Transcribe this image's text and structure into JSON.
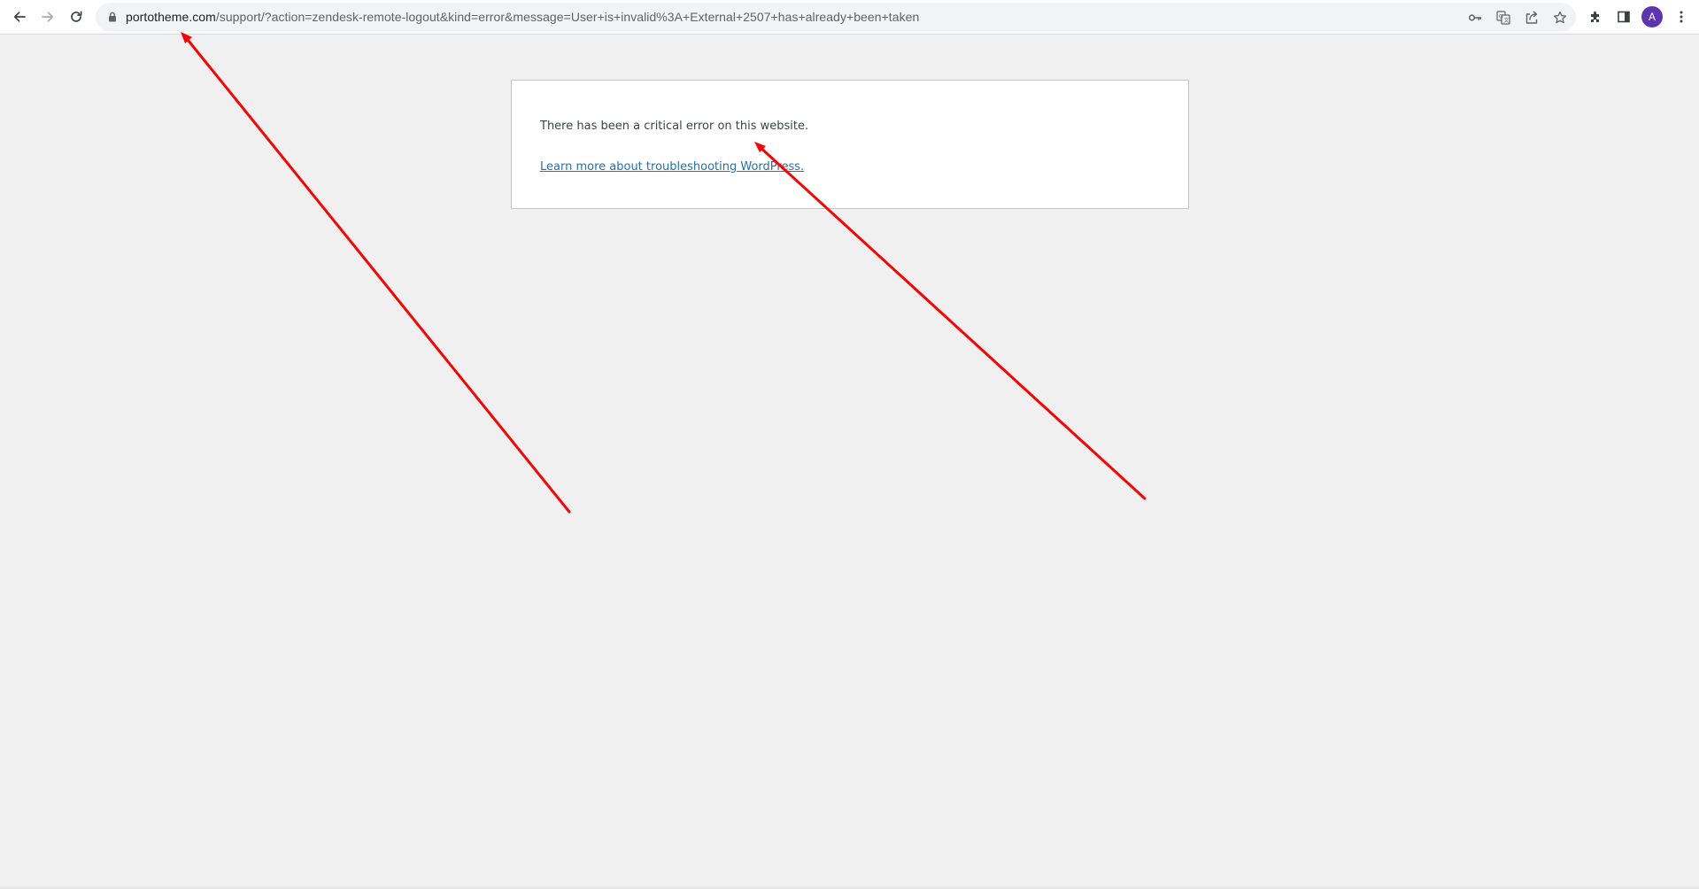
{
  "browser": {
    "url_host": "portotheme.com",
    "url_path": "/support/?action=zendesk-remote-logout&kind=error&message=User+is+invalid%3A+External+2507+has+already+been+taken",
    "avatar_letter": "A",
    "icons": {
      "back": "arrow-left-icon",
      "forward": "arrow-right-icon",
      "reload": "reload-icon",
      "lock": "lock-icon",
      "password": "key-icon",
      "translate": "translate-icon",
      "share": "share-icon",
      "bookmark": "star-icon",
      "extensions": "puzzle-icon",
      "side_panel": "side-panel-icon",
      "menu": "kebab-menu-icon"
    }
  },
  "page": {
    "error_message": "There has been a critical error on this website.",
    "help_link": "Learn more about troubleshooting WordPress."
  },
  "annotations": {
    "arrow_color": "#ff0000",
    "arrows": [
      "arrow-to-url",
      "arrow-to-error-message"
    ]
  },
  "colors": {
    "page_background": "#f0f0f1",
    "link": "#2271b1",
    "avatar": "#5e35b1"
  }
}
